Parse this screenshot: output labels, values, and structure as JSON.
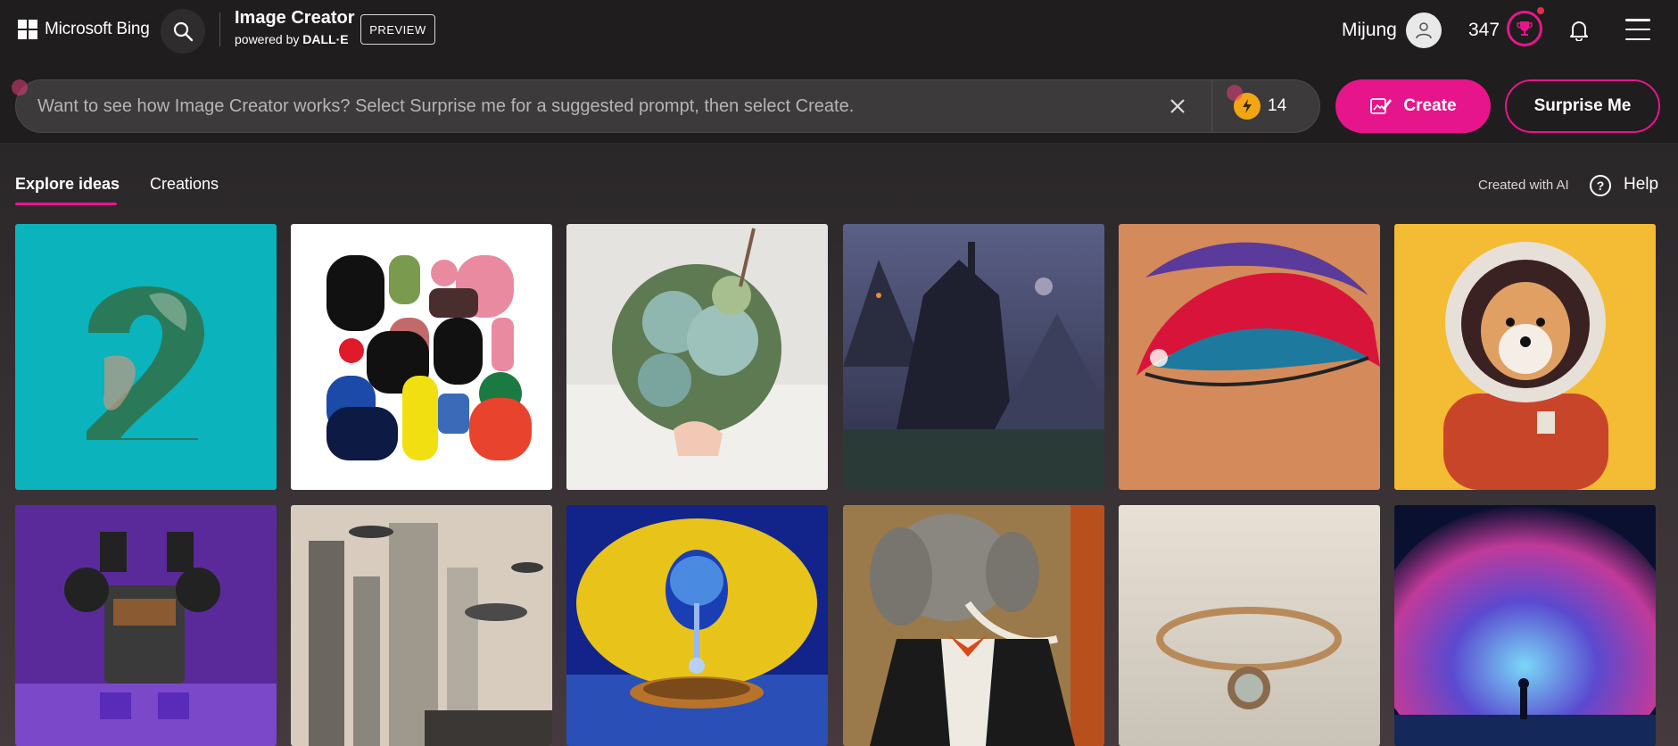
{
  "header": {
    "logo_text": "Microsoft Bing",
    "app_title": "Image Creator",
    "powered_by_prefix": "powered by",
    "powered_by_brand": "DALL·E",
    "preview_badge": "PREVIEW",
    "user_name": "Mijung",
    "points": "347"
  },
  "prompt": {
    "placeholder": "Want to see how Image Creator works? Select Surprise me for a suggested prompt, then select Create.",
    "value": "",
    "boosts": "14",
    "create_label": "Create",
    "surprise_label": "Surprise Me"
  },
  "tabs": {
    "explore": "Explore ideas",
    "creations": "Creations"
  },
  "meta": {
    "created_with_ai": "Created with AI",
    "help": "Help"
  },
  "gallery": [
    {
      "subject": "Number 2 cutout with leaf texture on teal background"
    },
    {
      "subject": "Abstract colorful geometric shapes"
    },
    {
      "subject": "Succulent bouquet held in hands"
    },
    {
      "subject": "Dark fantasy castle on mountains"
    },
    {
      "subject": "Colorful glitter eyeshadow closeup"
    },
    {
      "subject": "Shiba inu dog in astronaut suit"
    },
    {
      "subject": "Purple robot made of machine parts"
    },
    {
      "subject": "Foggy futuristic city with flying ships"
    },
    {
      "subject": "Surreal lemon with water drop"
    },
    {
      "subject": "Elephant in tuxedo portrait"
    },
    {
      "subject": "Gold ring with stone"
    },
    {
      "subject": "Person walking into cosmic nebula"
    }
  ],
  "colors": {
    "accent": "#e7158b",
    "background": "#1f1d1e",
    "boost": "#f3a614"
  }
}
